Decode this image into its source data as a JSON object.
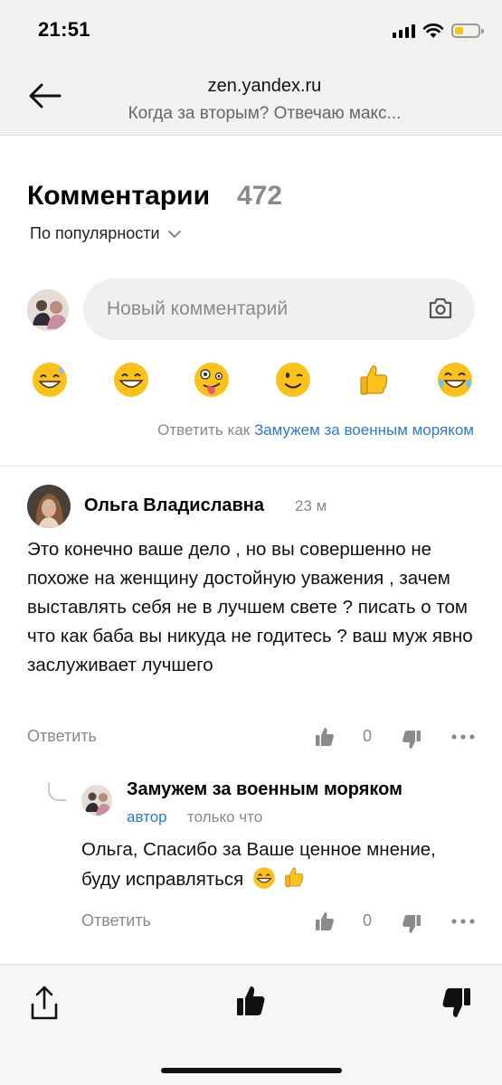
{
  "status_bar": {
    "time": "21:51"
  },
  "browser": {
    "domain": "zen.yandex.ru",
    "page_title": "Когда за вторым? Отвечаю макс..."
  },
  "comments": {
    "title": "Комментарии",
    "count": "472",
    "sort_label": "По популярности"
  },
  "new_comment": {
    "placeholder": "Новый комментарий",
    "reply_as_prefix": "Ответить как",
    "reply_as_name": "Замужем за военным моряком"
  },
  "emojis": [
    "grinning-sweat-icon",
    "grinning-squinting-icon",
    "zany-face-icon",
    "winking-face-icon",
    "thumbs-up-icon",
    "tears-of-joy-icon"
  ],
  "comment": {
    "author": "Ольга Владиславна",
    "time": "23 м",
    "text": "Это конечно ваше дело , но вы совершенно не похоже на женщину достойную уважения , зачем выставлять себя не в лучшем свете ? писать о том что как баба вы никуда не годитесь ? ваш муж явно заслуживает лучшего",
    "reply_label": "Ответить",
    "likes": "0"
  },
  "reply": {
    "author": "Замужем за военным моряком",
    "badge": "автор",
    "time": "только что",
    "text": "Ольга, Спасибо за Ваше ценное мнение, буду исправляться",
    "reply_label": "Ответить",
    "likes": "0"
  },
  "colors": {
    "accent": "#2a7ad8",
    "muted": "#888888",
    "chrome_bg": "#f2f1f0",
    "input_bg": "#f0f0f0",
    "battery": "#f5c518"
  }
}
